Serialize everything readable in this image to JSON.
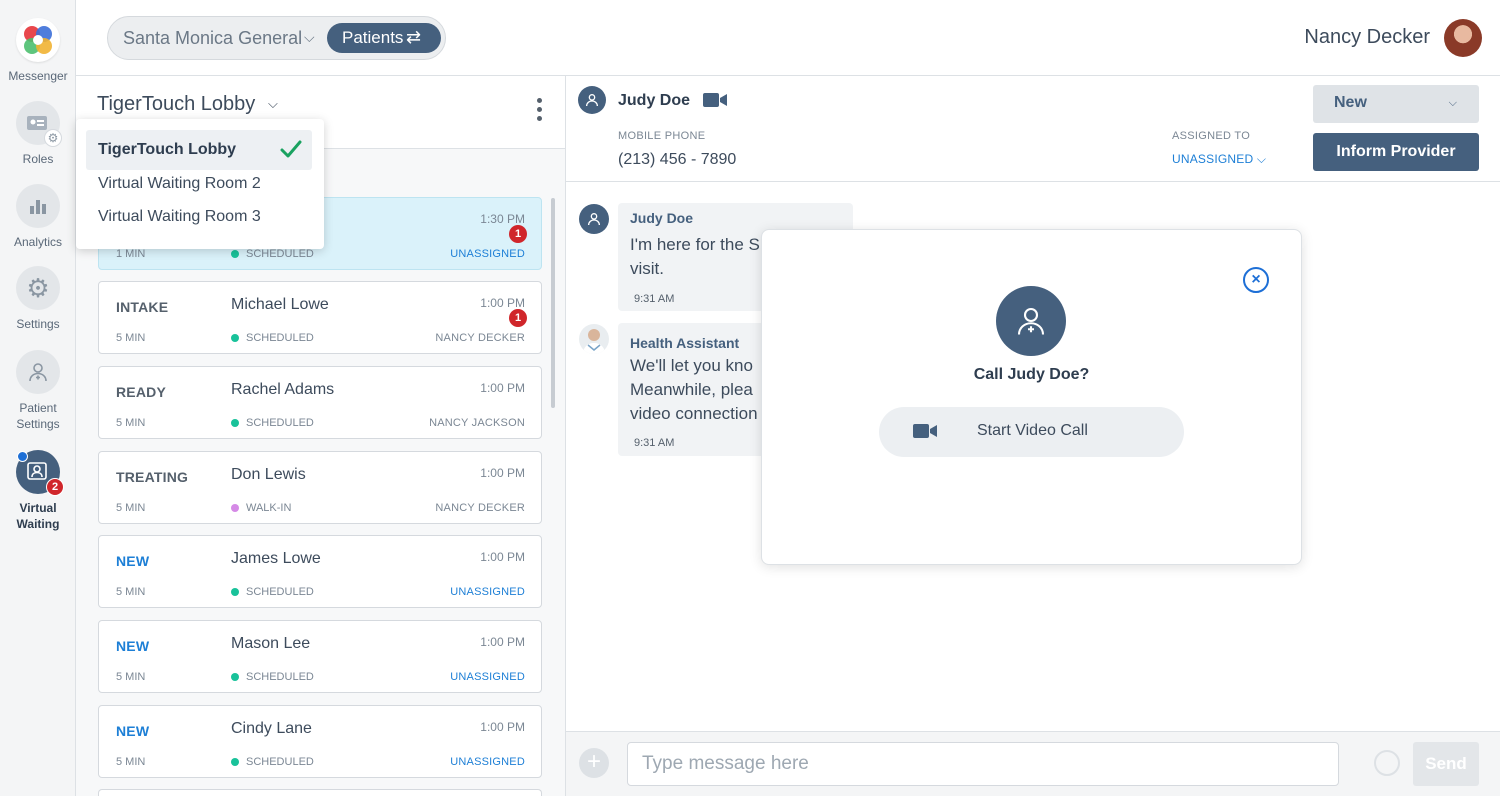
{
  "rail": {
    "items": [
      {
        "label": "Messenger"
      },
      {
        "label": "Roles"
      },
      {
        "label": "Analytics"
      },
      {
        "label": "Settings"
      },
      {
        "label": "Patient Settings"
      },
      {
        "label": "Virtual Waiting",
        "badge": "2"
      }
    ]
  },
  "header": {
    "organization": "Santa Monica General",
    "mode_label": "Patients",
    "user_name": "Nancy Decker"
  },
  "list": {
    "title": "TigerTouch Lobby",
    "dropdown": [
      "TigerTouch Lobby",
      "Virtual Waiting Room 2",
      "Virtual Waiting Room 3"
    ],
    "cards": [
      {
        "stage": "",
        "name": "",
        "time": "1:30 PM",
        "duration": "1 MIN",
        "type": "SCHEDULED",
        "assignee": "UNASSIGNED",
        "badge": "1"
      },
      {
        "stage": "INTAKE",
        "name": "Michael Lowe",
        "time": "1:00 PM",
        "duration": "5 MIN",
        "type": "SCHEDULED",
        "assignee": "NANCY DECKER",
        "badge": "1"
      },
      {
        "stage": "READY",
        "name": "Rachel Adams",
        "time": "1:00 PM",
        "duration": "5 MIN",
        "type": "SCHEDULED",
        "assignee": "NANCY JACKSON",
        "badge": ""
      },
      {
        "stage": "TREATING",
        "name": "Don Lewis",
        "time": "1:00 PM",
        "duration": "5 MIN",
        "type": "WALK-IN",
        "assignee": "NANCY DECKER",
        "badge": ""
      },
      {
        "stage": "NEW",
        "name": "James Lowe",
        "time": "1:00 PM",
        "duration": "5 MIN",
        "type": "SCHEDULED",
        "assignee": "UNASSIGNED",
        "badge": ""
      },
      {
        "stage": "NEW",
        "name": "Mason Lee",
        "time": "1:00 PM",
        "duration": "5 MIN",
        "type": "SCHEDULED",
        "assignee": "UNASSIGNED",
        "badge": ""
      },
      {
        "stage": "NEW",
        "name": "Cindy Lane",
        "time": "1:00 PM",
        "duration": "5 MIN",
        "type": "SCHEDULED",
        "assignee": "UNASSIGNED",
        "badge": ""
      }
    ]
  },
  "patient": {
    "name": "Judy Doe",
    "phone_label": "MOBILE PHONE",
    "phone": "(213) 456 - 7890",
    "assigned_label": "ASSIGNED TO",
    "assigned_value": "UNASSIGNED",
    "status": "New",
    "inform_label": "Inform Provider"
  },
  "chat": {
    "messages": [
      {
        "sender": "Judy Doe",
        "lines": [
          "I'm here for the S",
          "visit."
        ],
        "time": "9:31 AM"
      },
      {
        "sender": "Health Assistant",
        "lines": [
          "We'll let you kno",
          "Meanwhile, plea",
          "video connection"
        ],
        "time": "9:31 AM"
      }
    ]
  },
  "composer": {
    "placeholder": "Type message here",
    "send_label": "Send"
  },
  "modal": {
    "title": "Call Judy Doe?",
    "button_label": "Start Video Call"
  },
  "colors": {
    "primary": "#45607e",
    "link": "#1d7fd6",
    "alert": "#d0262b",
    "highlight": "#daf2fa",
    "scheduled_dot": "#19c29a",
    "walkin_dot": "#d58ae6",
    "check": "#1aa260"
  }
}
